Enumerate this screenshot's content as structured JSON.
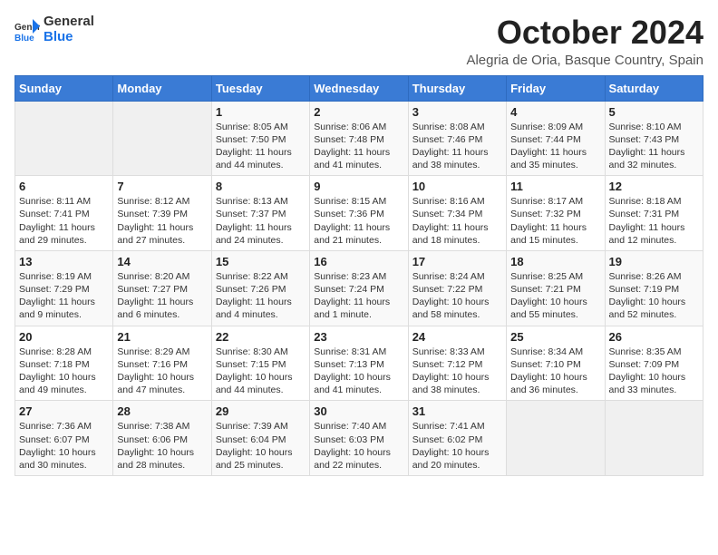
{
  "header": {
    "logo_general": "General",
    "logo_blue": "Blue",
    "month_title": "October 2024",
    "location": "Alegria de Oria, Basque Country, Spain"
  },
  "days_of_week": [
    "Sunday",
    "Monday",
    "Tuesday",
    "Wednesday",
    "Thursday",
    "Friday",
    "Saturday"
  ],
  "weeks": [
    [
      {
        "day": "",
        "sunrise": "",
        "sunset": "",
        "daylight": ""
      },
      {
        "day": "",
        "sunrise": "",
        "sunset": "",
        "daylight": ""
      },
      {
        "day": "1",
        "sunrise": "Sunrise: 8:05 AM",
        "sunset": "Sunset: 7:50 PM",
        "daylight": "Daylight: 11 hours and 44 minutes."
      },
      {
        "day": "2",
        "sunrise": "Sunrise: 8:06 AM",
        "sunset": "Sunset: 7:48 PM",
        "daylight": "Daylight: 11 hours and 41 minutes."
      },
      {
        "day": "3",
        "sunrise": "Sunrise: 8:08 AM",
        "sunset": "Sunset: 7:46 PM",
        "daylight": "Daylight: 11 hours and 38 minutes."
      },
      {
        "day": "4",
        "sunrise": "Sunrise: 8:09 AM",
        "sunset": "Sunset: 7:44 PM",
        "daylight": "Daylight: 11 hours and 35 minutes."
      },
      {
        "day": "5",
        "sunrise": "Sunrise: 8:10 AM",
        "sunset": "Sunset: 7:43 PM",
        "daylight": "Daylight: 11 hours and 32 minutes."
      }
    ],
    [
      {
        "day": "6",
        "sunrise": "Sunrise: 8:11 AM",
        "sunset": "Sunset: 7:41 PM",
        "daylight": "Daylight: 11 hours and 29 minutes."
      },
      {
        "day": "7",
        "sunrise": "Sunrise: 8:12 AM",
        "sunset": "Sunset: 7:39 PM",
        "daylight": "Daylight: 11 hours and 27 minutes."
      },
      {
        "day": "8",
        "sunrise": "Sunrise: 8:13 AM",
        "sunset": "Sunset: 7:37 PM",
        "daylight": "Daylight: 11 hours and 24 minutes."
      },
      {
        "day": "9",
        "sunrise": "Sunrise: 8:15 AM",
        "sunset": "Sunset: 7:36 PM",
        "daylight": "Daylight: 11 hours and 21 minutes."
      },
      {
        "day": "10",
        "sunrise": "Sunrise: 8:16 AM",
        "sunset": "Sunset: 7:34 PM",
        "daylight": "Daylight: 11 hours and 18 minutes."
      },
      {
        "day": "11",
        "sunrise": "Sunrise: 8:17 AM",
        "sunset": "Sunset: 7:32 PM",
        "daylight": "Daylight: 11 hours and 15 minutes."
      },
      {
        "day": "12",
        "sunrise": "Sunrise: 8:18 AM",
        "sunset": "Sunset: 7:31 PM",
        "daylight": "Daylight: 11 hours and 12 minutes."
      }
    ],
    [
      {
        "day": "13",
        "sunrise": "Sunrise: 8:19 AM",
        "sunset": "Sunset: 7:29 PM",
        "daylight": "Daylight: 11 hours and 9 minutes."
      },
      {
        "day": "14",
        "sunrise": "Sunrise: 8:20 AM",
        "sunset": "Sunset: 7:27 PM",
        "daylight": "Daylight: 11 hours and 6 minutes."
      },
      {
        "day": "15",
        "sunrise": "Sunrise: 8:22 AM",
        "sunset": "Sunset: 7:26 PM",
        "daylight": "Daylight: 11 hours and 4 minutes."
      },
      {
        "day": "16",
        "sunrise": "Sunrise: 8:23 AM",
        "sunset": "Sunset: 7:24 PM",
        "daylight": "Daylight: 11 hours and 1 minute."
      },
      {
        "day": "17",
        "sunrise": "Sunrise: 8:24 AM",
        "sunset": "Sunset: 7:22 PM",
        "daylight": "Daylight: 10 hours and 58 minutes."
      },
      {
        "day": "18",
        "sunrise": "Sunrise: 8:25 AM",
        "sunset": "Sunset: 7:21 PM",
        "daylight": "Daylight: 10 hours and 55 minutes."
      },
      {
        "day": "19",
        "sunrise": "Sunrise: 8:26 AM",
        "sunset": "Sunset: 7:19 PM",
        "daylight": "Daylight: 10 hours and 52 minutes."
      }
    ],
    [
      {
        "day": "20",
        "sunrise": "Sunrise: 8:28 AM",
        "sunset": "Sunset: 7:18 PM",
        "daylight": "Daylight: 10 hours and 49 minutes."
      },
      {
        "day": "21",
        "sunrise": "Sunrise: 8:29 AM",
        "sunset": "Sunset: 7:16 PM",
        "daylight": "Daylight: 10 hours and 47 minutes."
      },
      {
        "day": "22",
        "sunrise": "Sunrise: 8:30 AM",
        "sunset": "Sunset: 7:15 PM",
        "daylight": "Daylight: 10 hours and 44 minutes."
      },
      {
        "day": "23",
        "sunrise": "Sunrise: 8:31 AM",
        "sunset": "Sunset: 7:13 PM",
        "daylight": "Daylight: 10 hours and 41 minutes."
      },
      {
        "day": "24",
        "sunrise": "Sunrise: 8:33 AM",
        "sunset": "Sunset: 7:12 PM",
        "daylight": "Daylight: 10 hours and 38 minutes."
      },
      {
        "day": "25",
        "sunrise": "Sunrise: 8:34 AM",
        "sunset": "Sunset: 7:10 PM",
        "daylight": "Daylight: 10 hours and 36 minutes."
      },
      {
        "day": "26",
        "sunrise": "Sunrise: 8:35 AM",
        "sunset": "Sunset: 7:09 PM",
        "daylight": "Daylight: 10 hours and 33 minutes."
      }
    ],
    [
      {
        "day": "27",
        "sunrise": "Sunrise: 7:36 AM",
        "sunset": "Sunset: 6:07 PM",
        "daylight": "Daylight: 10 hours and 30 minutes."
      },
      {
        "day": "28",
        "sunrise": "Sunrise: 7:38 AM",
        "sunset": "Sunset: 6:06 PM",
        "daylight": "Daylight: 10 hours and 28 minutes."
      },
      {
        "day": "29",
        "sunrise": "Sunrise: 7:39 AM",
        "sunset": "Sunset: 6:04 PM",
        "daylight": "Daylight: 10 hours and 25 minutes."
      },
      {
        "day": "30",
        "sunrise": "Sunrise: 7:40 AM",
        "sunset": "Sunset: 6:03 PM",
        "daylight": "Daylight: 10 hours and 22 minutes."
      },
      {
        "day": "31",
        "sunrise": "Sunrise: 7:41 AM",
        "sunset": "Sunset: 6:02 PM",
        "daylight": "Daylight: 10 hours and 20 minutes."
      },
      {
        "day": "",
        "sunrise": "",
        "sunset": "",
        "daylight": ""
      },
      {
        "day": "",
        "sunrise": "",
        "sunset": "",
        "daylight": ""
      }
    ]
  ]
}
